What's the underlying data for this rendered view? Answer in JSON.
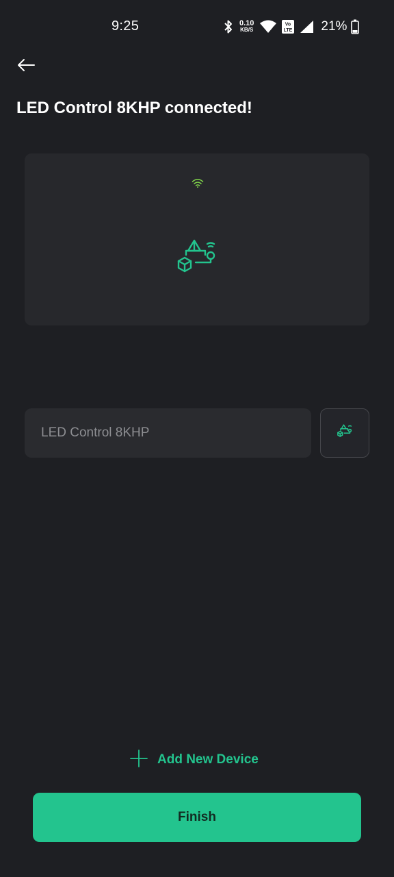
{
  "status_bar": {
    "time": "9:25",
    "net_speed_value": "0.10",
    "net_speed_unit": "KB/S",
    "battery_percent": "21%",
    "icons": [
      "bluetooth-icon",
      "wifi-icon",
      "volte-icon",
      "signal-icon",
      "battery-icon"
    ]
  },
  "header": {
    "back_icon": "arrow-left-icon",
    "title": "LED Control 8KHP connected!"
  },
  "device_card": {
    "status_icon": "wifi-icon",
    "device_icon": "device-template-icon"
  },
  "device_name": {
    "placeholder": "LED Control 8KHP",
    "value": ""
  },
  "icon_picker": {
    "icon": "device-template-icon"
  },
  "actions": {
    "add_device_label": "Add New Device",
    "finish_label": "Finish"
  },
  "colors": {
    "background": "#1e1f23",
    "card": "#27282c",
    "accent": "#23c48e",
    "wifi_green": "#7fd34a"
  }
}
